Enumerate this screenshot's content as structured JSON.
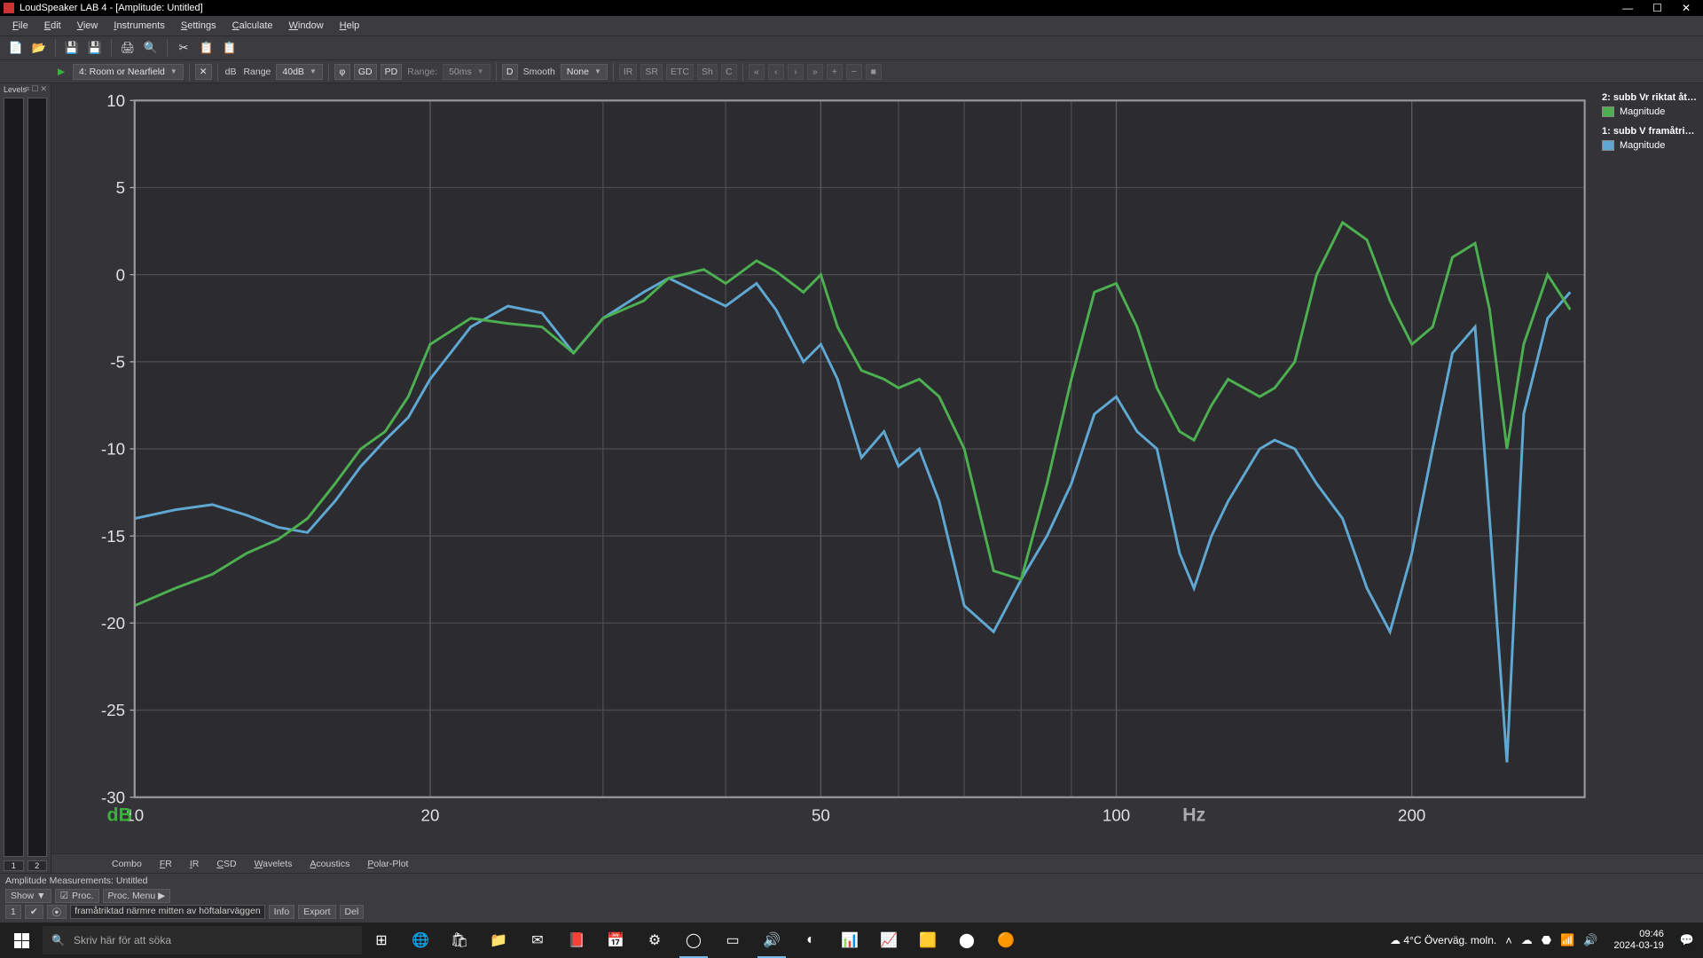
{
  "window": {
    "title": "LoudSpeaker LAB 4 - [Amplitude: Untitled]",
    "minimize": "—",
    "maximize": "☐",
    "close": "✕"
  },
  "menu": {
    "file": "File",
    "edit": "Edit",
    "view": "View",
    "instruments": "Instruments",
    "settings": "Settings",
    "calculate": "Calculate",
    "window": "Window",
    "help": "Help"
  },
  "toolbar2": {
    "measurementMode": "4: Room or Nearfield",
    "dB": "dB",
    "range": "Range",
    "rangeValue": "40dB",
    "phi": "φ",
    "gd": "GD",
    "pd": "PD",
    "rangeTime": "Range:",
    "rangeTimeValue": "50ms",
    "d": "D",
    "smooth": "Smooth",
    "smoothValue": "None",
    "ir": "IR",
    "sr": "SR",
    "etc": "ETC",
    "sh": "Sh",
    "c": "C"
  },
  "levels": {
    "title": "Levels",
    "ch1": "1",
    "ch2": "2"
  },
  "legend": {
    "series2Title": "2: subb Vr riktat åt ...",
    "series2Label": "Magnitude",
    "series1Title": "1: subb V framåtrikt...",
    "series1Label": "Magnitude"
  },
  "tabs": {
    "combo": "Combo",
    "fr": "FR",
    "ir": "IR",
    "csd": "CSD",
    "wavelets": "Wavelets",
    "acoustics": "Acoustics",
    "polar": "Polar-Plot"
  },
  "bottom": {
    "title": "Amplitude Measurements: Untitled",
    "show": "Show ▼",
    "proc": "Proc.",
    "procMenu": "Proc. Menu ▶",
    "row1Num": "1",
    "row1Text": "framåtriktad närmre mitten av höftalarväggen",
    "info": "Info",
    "export": "Export",
    "del": "Del"
  },
  "taskbar": {
    "searchPlaceholder": "Skriv här för att söka",
    "weather": "4°C  Överväg. moln.",
    "time": "09:46",
    "date": "2024-03-19"
  },
  "chart_data": {
    "type": "line",
    "xlabel": "Hz",
    "ylabel": "dB",
    "xscale": "log",
    "xlim": [
      10,
      300
    ],
    "ylim": [
      -30,
      10
    ],
    "xticks": [
      10,
      20,
      50,
      100,
      200
    ],
    "yticks": [
      -30,
      -25,
      -20,
      -15,
      -10,
      -5,
      0,
      5,
      10
    ],
    "colors": {
      "series1": "#5fa8d3",
      "series2": "#4caf50"
    },
    "series": [
      {
        "name": "1: subb V framåtrikt... (Magnitude)",
        "color": "#5fa8d3",
        "x": [
          10,
          11,
          12,
          13,
          14,
          15,
          16,
          17,
          18,
          19,
          20,
          22,
          24,
          26,
          28,
          30,
          33,
          35,
          38,
          40,
          43,
          45,
          48,
          50,
          52,
          55,
          58,
          60,
          63,
          66,
          70,
          75,
          80,
          85,
          90,
          95,
          100,
          105,
          110,
          116,
          120,
          125,
          130,
          140,
          145,
          152,
          160,
          170,
          180,
          190,
          200,
          210,
          220,
          232,
          240,
          250,
          260,
          275,
          290
        ],
        "y": [
          -14,
          -13.5,
          -13.2,
          -13.8,
          -14.5,
          -14.8,
          -13,
          -11,
          -9.5,
          -8.2,
          -6,
          -3,
          -1.8,
          -2.2,
          -4.5,
          -2.5,
          -1,
          -0.2,
          -1.2,
          -1.8,
          -0.5,
          -2,
          -5,
          -4,
          -6,
          -10.5,
          -9,
          -11,
          -10,
          -13,
          -19,
          -20.5,
          -17.5,
          -15,
          -12,
          -8,
          -7,
          -9,
          -10,
          -16,
          -18,
          -15,
          -13,
          -10,
          -9.5,
          -10,
          -12,
          -14,
          -18,
          -20.5,
          -16,
          -10,
          -4.5,
          -3,
          -14,
          -28,
          -8,
          -2.5,
          -1
        ]
      },
      {
        "name": "2: subb Vr riktat åt ... (Magnitude)",
        "color": "#4caf50",
        "x": [
          10,
          11,
          12,
          13,
          14,
          15,
          16,
          17,
          18,
          19,
          20,
          22,
          24,
          26,
          28,
          30,
          33,
          35,
          38,
          40,
          43,
          45,
          48,
          50,
          52,
          55,
          58,
          60,
          63,
          66,
          70,
          75,
          80,
          85,
          90,
          95,
          100,
          105,
          110,
          116,
          120,
          125,
          130,
          140,
          145,
          152,
          160,
          170,
          180,
          190,
          200,
          210,
          220,
          232,
          240,
          250,
          260,
          275,
          290
        ],
        "y": [
          -19,
          -18,
          -17.2,
          -16,
          -15.2,
          -14,
          -12,
          -10,
          -9,
          -7,
          -4,
          -2.5,
          -2.8,
          -3,
          -4.5,
          -2.5,
          -1.5,
          -0.2,
          0.3,
          -0.5,
          0.8,
          0.2,
          -1,
          0,
          -3,
          -5.5,
          -6,
          -6.5,
          -6,
          -7,
          -10,
          -17,
          -17.5,
          -12,
          -6,
          -1,
          -0.5,
          -3,
          -6.5,
          -9,
          -9.5,
          -7.5,
          -6,
          -7,
          -6.5,
          -5,
          0,
          3,
          2,
          -1.5,
          -4,
          -3,
          1,
          1.8,
          -2,
          -10,
          -4,
          0,
          -2
        ]
      }
    ]
  }
}
